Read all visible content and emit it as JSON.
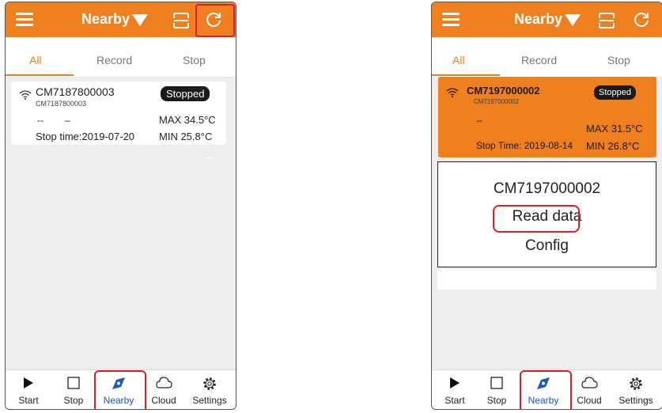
{
  "left": {
    "header": {
      "title": "Nearby"
    },
    "tabs": [
      {
        "label": "All"
      },
      {
        "label": "Record"
      },
      {
        "label": "Stop"
      }
    ],
    "device": {
      "id": "CM7187800003",
      "sub_id": "CM7187800003",
      "status": "Stopped",
      "dash1": "--",
      "dash2": "–",
      "max": "MAX 34.5°C",
      "min": "MIN  25.8°C",
      "stop_time": "Stop time:2019-07-20"
    },
    "nav": [
      {
        "label": "Start",
        "icon": "play-icon"
      },
      {
        "label": "Stop",
        "icon": "stop-square-icon"
      },
      {
        "label": "Nearby",
        "icon": "compass-icon"
      },
      {
        "label": "Cloud",
        "icon": "cloud-icon"
      },
      {
        "label": "Settings",
        "icon": "gear-icon"
      }
    ]
  },
  "right": {
    "header": {
      "title": "Nearby"
    },
    "tabs": [
      {
        "label": "All"
      },
      {
        "label": "Record"
      },
      {
        "label": "Stop"
      }
    ],
    "device": {
      "id": "CM7197000002",
      "sub_id": "CM7197000002",
      "status": "Stopped",
      "dash1": "–",
      "max": "MAX 31.5°C",
      "min": "MIN  26.8°C",
      "stop_time": "Stop Time: 2019-08-14"
    },
    "menu": {
      "title": "CM7197000002",
      "read": "Read data",
      "config": "Config"
    },
    "nav": [
      {
        "label": "Start",
        "icon": "play-icon"
      },
      {
        "label": "Stop",
        "icon": "stop-square-icon"
      },
      {
        "label": "Nearby",
        "icon": "compass-icon"
      },
      {
        "label": "Cloud",
        "icon": "cloud-icon"
      },
      {
        "label": "Settings",
        "icon": "gear-icon"
      }
    ]
  },
  "colors": {
    "accent": "#f0801f",
    "highlight": "#d6202a",
    "nav_active": "#1e58b8",
    "badge": "#1a1a1a"
  }
}
